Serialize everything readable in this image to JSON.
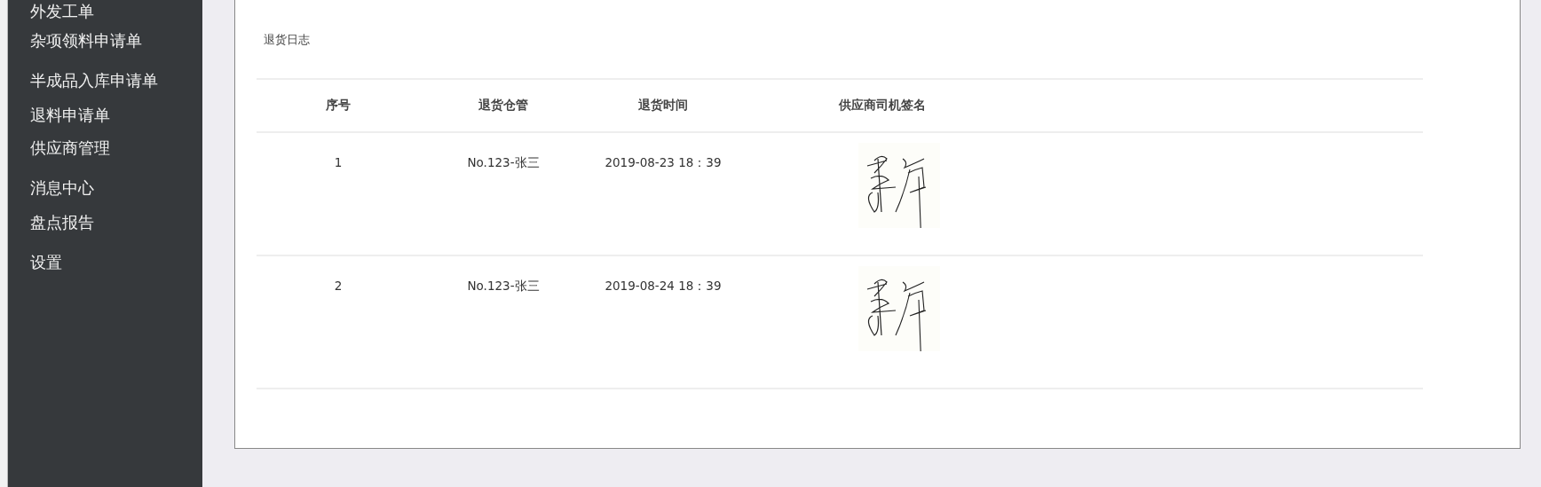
{
  "sidebar": {
    "items": [
      {
        "label": "外发工单"
      },
      {
        "label": "杂项领料申请单"
      },
      {
        "label": "半成品入库申请单"
      },
      {
        "label": "退料申请单"
      },
      {
        "label": "供应商管理"
      },
      {
        "label": "消息中心"
      },
      {
        "label": "盘点报告"
      },
      {
        "label": "设置"
      }
    ]
  },
  "card": {
    "title": "退货日志",
    "table": {
      "columns": [
        "序号",
        "退货仓管",
        "退货时间",
        "供应商司机签名"
      ],
      "rows": [
        {
          "index": "1",
          "keeper": "No.123-张三",
          "time": "2019-08-23 18：39"
        },
        {
          "index": "2",
          "keeper": "No.123-张三",
          "time": "2019-08-24 18：39"
        }
      ]
    }
  }
}
